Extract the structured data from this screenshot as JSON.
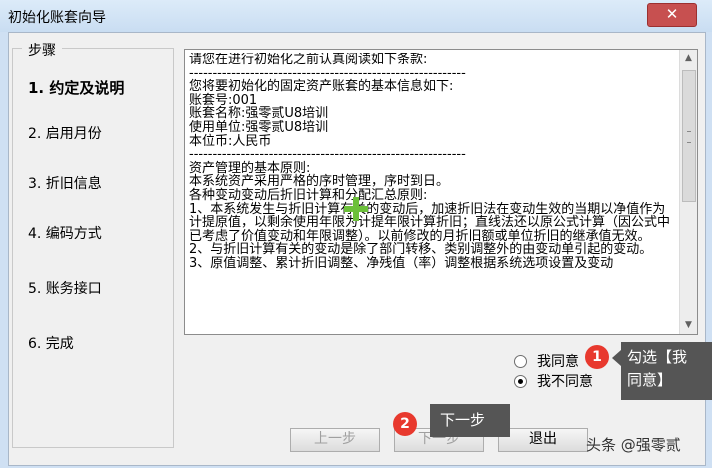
{
  "window": {
    "title": "初始化账套向导",
    "close_glyph": "✕"
  },
  "steps": {
    "legend": "步骤",
    "items": [
      {
        "label": "1. 约定及说明",
        "active": true
      },
      {
        "label": "2. 启用月份",
        "active": false
      },
      {
        "label": "3. 折旧信息",
        "active": false
      },
      {
        "label": "4. 编码方式",
        "active": false
      },
      {
        "label": "5. 账务接口",
        "active": false
      },
      {
        "label": "6. 完成",
        "active": false
      }
    ]
  },
  "terms": {
    "text": "请您在进行初始化之前认真阅读如下条款:\n-----------------------------------------------------------\n您将要初始化的固定资产账套的基本信息如下:\n账套号:001\n账套名称:强零贰U8培训\n使用单位:强零贰U8培训\n本位币:人民币\n-----------------------------------------------------------\n资产管理的基本原则:\n本系统资产采用严格的序时管理，序时到日。\n各种变动变动后折旧计算和分配汇总原则:\n1、本系统发生与折旧计算有关的变动后，加速折旧法在变动生效的当期以净值作为计提原值，以剩余使用年限为计提年限计算折旧；直线法还以原公式计算（因公式中已考虑了价值变动和年限调整）。以前修改的月折旧额或单位折旧的继承值无效。\n2、与折旧计算有关的变动是除了部门转移、类别调整外的由变动单引起的变动。\n3、原值调整、累计折旧调整、净残值（率）调整根据系统选项设置及变动"
  },
  "agreement": {
    "agree_label": "我同意",
    "disagree_label": "我不同意",
    "selected": "disagree"
  },
  "buttons": {
    "prev": "上一步",
    "next": "下一步",
    "exit": "退出"
  },
  "annotations": {
    "badge1": "1",
    "tip1_line1": "勾选【我",
    "tip1_line2": "同意】",
    "badge2": "2",
    "tip2": "下一步"
  },
  "watermark": "头条 @强零贰",
  "colors": {
    "badge": "#e8392e",
    "tooltip": "#555555",
    "close": "#c75050"
  }
}
